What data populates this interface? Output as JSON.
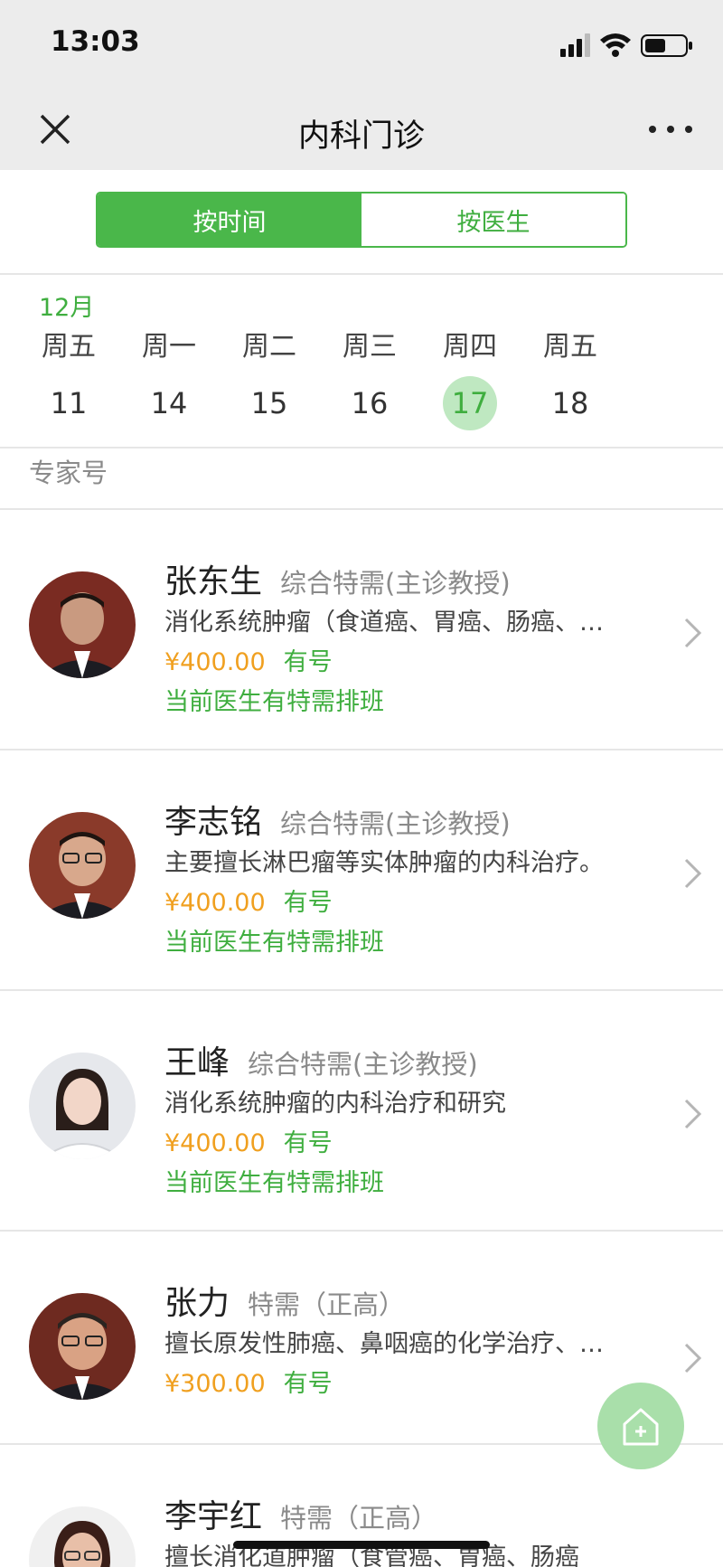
{
  "status_bar": {
    "time": "13:03"
  },
  "nav": {
    "title": "内科门诊"
  },
  "segment": {
    "by_time": "按时间",
    "by_doctor": "按医生"
  },
  "calendar": {
    "month": "12月",
    "days": [
      {
        "weekday": "周五",
        "date": "11",
        "selected": false
      },
      {
        "weekday": "周一",
        "date": "14",
        "selected": false
      },
      {
        "weekday": "周二",
        "date": "15",
        "selected": false
      },
      {
        "weekday": "周三",
        "date": "16",
        "selected": false
      },
      {
        "weekday": "周四",
        "date": "17",
        "selected": true
      },
      {
        "weekday": "周五",
        "date": "18",
        "selected": false
      }
    ]
  },
  "section": {
    "label": "专家号"
  },
  "doctors": [
    {
      "name": "张东生",
      "title": "综合特需(主诊教授)",
      "specialty": "消化系统肿瘤（食道癌、胃癌、肠癌、…",
      "price": "¥400.00",
      "availability": "有号",
      "note": "当前医生有特需排班"
    },
    {
      "name": "李志铭",
      "title": "综合特需(主诊教授)",
      "specialty": "主要擅长淋巴瘤等实体肿瘤的内科治疗。",
      "price": "¥400.00",
      "availability": "有号",
      "note": "当前医生有特需排班"
    },
    {
      "name": "王峰",
      "title": "综合特需(主诊教授)",
      "specialty": "消化系统肿瘤的内科治疗和研究",
      "price": "¥400.00",
      "availability": "有号",
      "note": "当前医生有特需排班"
    },
    {
      "name": "张力",
      "title": "特需（正高）",
      "specialty": "擅长原发性肺癌、鼻咽癌的化学治疗、…",
      "price": "¥300.00",
      "availability": "有号",
      "note": ""
    },
    {
      "name": "李宇红",
      "title": "特需（正高）",
      "specialty": "擅长消化道肿瘤（食管癌、胃癌、肠癌",
      "price": "",
      "availability": "",
      "note": ""
    }
  ],
  "colors": {
    "accent": "#4ab74a",
    "price": "#f0a020",
    "nav_bg": "#ececec"
  }
}
